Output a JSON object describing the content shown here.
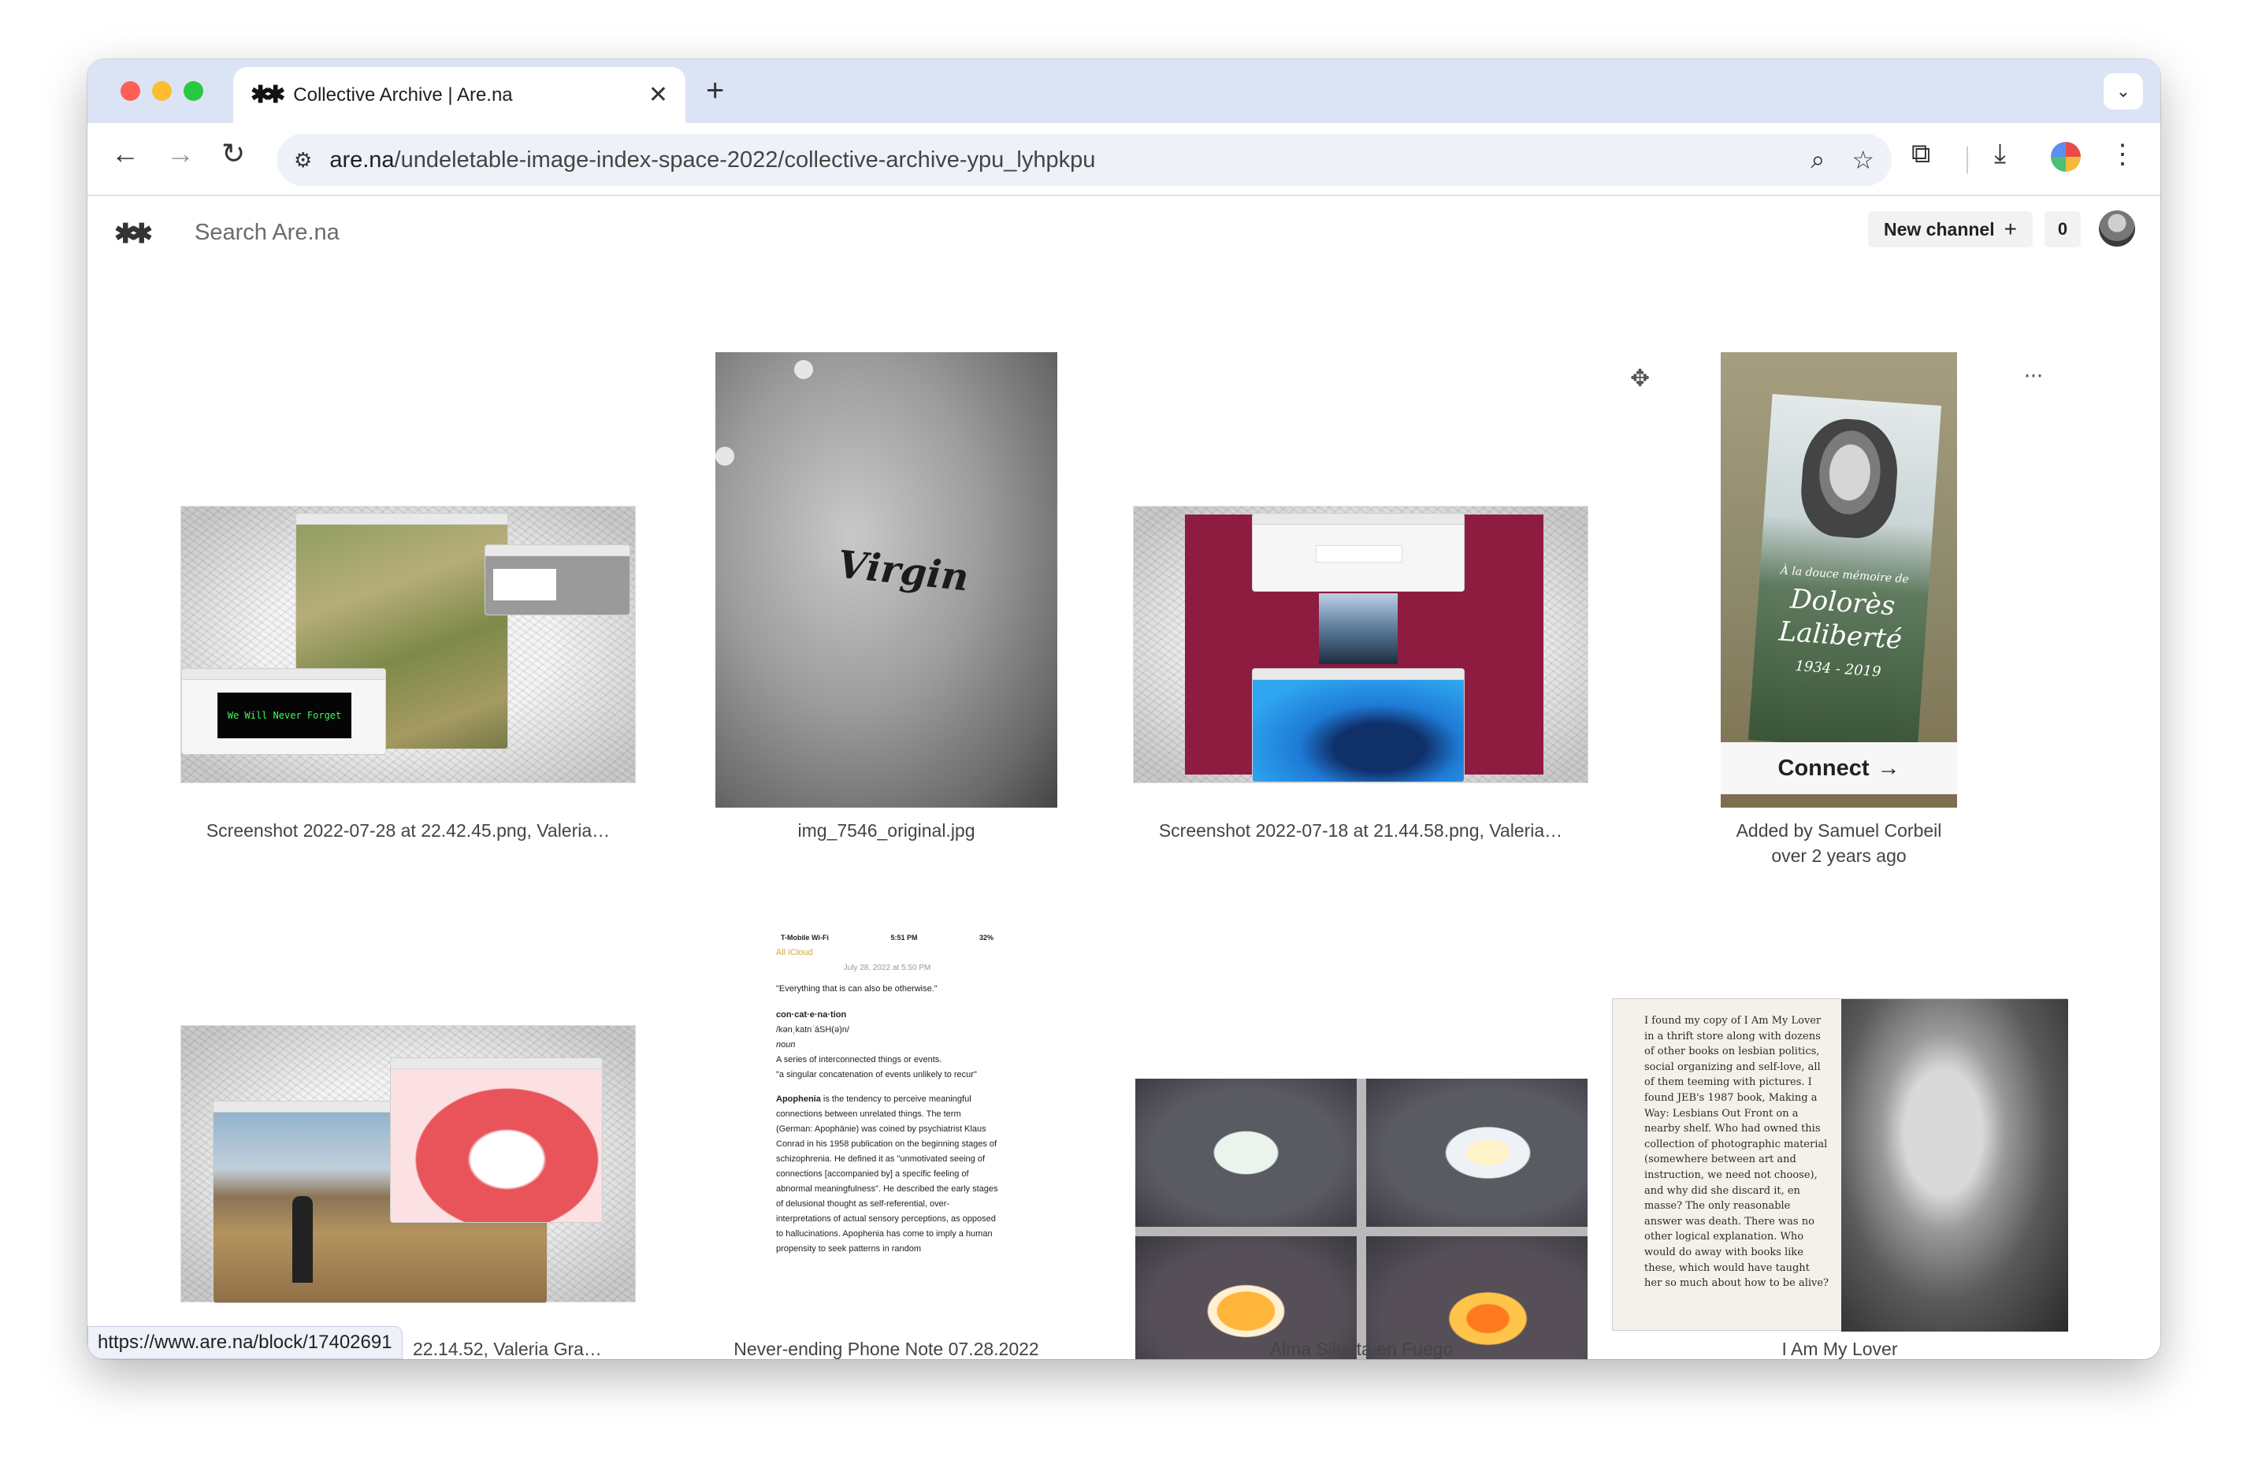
{
  "browser": {
    "tab": {
      "favicon": "✱✱",
      "title": "Collective Archive | Are.na",
      "close": "✕"
    },
    "new_tab": "+",
    "tab_dropdown": "⌄",
    "url_host": "are.na",
    "url_path": "/undeletable-image-index-space-2022/collective-archive-ypu_lyhpkpu",
    "status_url": "https://www.are.na/block/17402691"
  },
  "header": {
    "logo": "✱✱",
    "search_placeholder": "Search Are.na",
    "new_channel_label": "New channel",
    "new_channel_plus": "+",
    "notification_count": "0"
  },
  "blocks": [
    {
      "caption": "Screenshot 2022-07-28 at 22.42.45.png, Valeria…"
    },
    {
      "caption": "img_7546_original.jpg",
      "image_text": "Virgin"
    },
    {
      "caption": "Screenshot 2022-07-18 at 21.44.58.png, Valeria…"
    },
    {
      "caption_line1": "Added by Samuel Corbeil",
      "caption_line2": "over 2 years ago",
      "connect_label": "Connect",
      "connect_arrow": "→",
      "card_text_1": "À la douce mémoire de",
      "card_text_2": "Dolorès",
      "card_text_3": "Laliberté",
      "card_text_4": "1934 - 2019"
    },
    {
      "caption": "22.14.52, Valeria Gra…"
    },
    {
      "caption": "Never-ending Phone Note 07.28.2022"
    },
    {
      "caption": "Alma Silueta en Fuego"
    },
    {
      "caption": "I Am My Lover"
    }
  ],
  "inner_screenshot_text": "We Will Never Forget",
  "phone_note": {
    "status_carrier": "T-Mobile Wi-Fi",
    "status_time": "5:51 PM",
    "status_battery": "32%",
    "back_label": "All iCloud",
    "date": "July 28, 2022 at 5:50 PM",
    "quote": "\"Everything that is can also be otherwise.\"",
    "word": "con·cat·e·na·tion",
    "pron": "/kənˌkatnˈāSH(ə)n/",
    "pos": "noun",
    "def1": "A series of interconnected things or events.",
    "def2": "\"a singular concatenation of events unlikely to recur\"",
    "apo_title": "Apophenia",
    "apo_body": "is the tendency to perceive meaningful connections between unrelated things. The term (German: Apophänie) was coined by psychiatrist Klaus Conrad in his 1958 publication on the beginning stages of schizophrenia. He defined it as \"unmotivated seeing of connections [accompanied by] a specific feeling of abnormal meaningfulness\". He described the early stages of delusional thought as self-referential, over-interpretations of actual sensory perceptions, as opposed to hallucinations. Apophenia has come to imply a human propensity to seek patterns in random"
  },
  "book_text": "I found my copy of I Am My Lover in a thrift store along with dozens of other books on lesbian politics, social organizing and self-love, all of them teeming with pictures. I found JEB's 1987 book, Making a Way: Lesbians Out Front on a nearby shelf. Who had owned this collection of photographic material (somewhere between art and instruction, we need not choose), and why did she discard it, en masse? The only reasonable answer was death. There was no other logical explanation. Who would do away with books like these, which would have taught her so much about how to be alive?",
  "block_actions": {
    "move_icon": "✥",
    "more_icon": "···"
  },
  "colors": {
    "accent_link": "#d4a537",
    "tab_bar": "#dbe4f5"
  }
}
